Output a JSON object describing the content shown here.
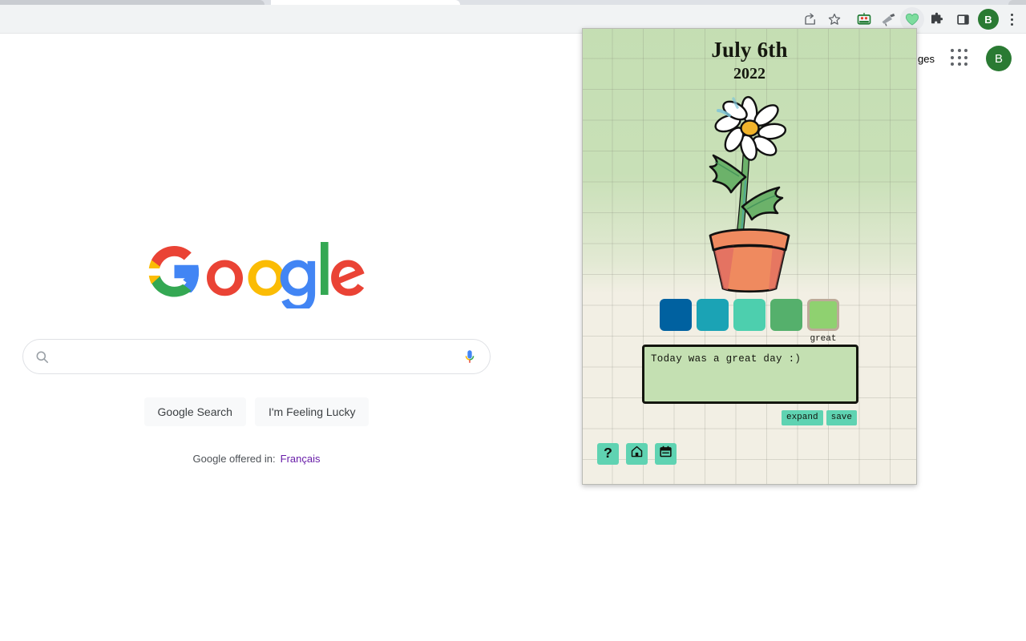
{
  "browser": {
    "toolbar_icons": [
      {
        "name": "share-icon",
        "glyph": "share"
      },
      {
        "name": "bookmark-star-icon",
        "glyph": "star"
      }
    ],
    "extensions": [
      {
        "name": "robot-extension-icon",
        "label": ""
      },
      {
        "name": "telescope-extension-icon",
        "label": ""
      },
      {
        "name": "green-heart-extension-icon",
        "label": "",
        "active": true
      },
      {
        "name": "puzzle-extensions-icon",
        "label": ""
      }
    ],
    "side_panel_label": "",
    "profile_initial": "B",
    "menu_label": ""
  },
  "google": {
    "header_link": "ges",
    "apps_label": "",
    "profile_initial": "B",
    "logo_text": "Google",
    "search": {
      "value": "",
      "placeholder": ""
    },
    "buttons": {
      "search": "Google Search",
      "lucky": "I'm Feeling Lucky"
    },
    "offered": {
      "text": "Google offered in:",
      "language": "Français"
    }
  },
  "popup": {
    "date": "July 6th",
    "year": "2022",
    "plant": {
      "name": "daisy-in-pot",
      "flower_color": "#ffffff",
      "center_color": "#f2b42c",
      "stem_color": "#6cb26a",
      "pot_color": "#ef8a5f",
      "soil_color": "#7d1f20"
    },
    "mood_colors": [
      {
        "name": "mood-swatch-1",
        "hex": "#0061a0",
        "selected": false
      },
      {
        "name": "mood-swatch-2",
        "hex": "#1ba3b5",
        "selected": false
      },
      {
        "name": "mood-swatch-3",
        "hex": "#4dcfae",
        "selected": false
      },
      {
        "name": "mood-swatch-4",
        "hex": "#55b06c",
        "selected": false
      },
      {
        "name": "mood-swatch-5",
        "hex": "#8fd170",
        "selected": true
      }
    ],
    "selected_mood_label": "great",
    "entry": {
      "value": "Today was a great day :)",
      "placeholder": ""
    },
    "entry_actions": {
      "expand": "expand",
      "save": "save"
    },
    "tools": [
      {
        "name": "help-button",
        "glyph": "?"
      },
      {
        "name": "home-button",
        "glyph": "home"
      },
      {
        "name": "calendar-button",
        "glyph": "calendar"
      }
    ],
    "accent_color": "#5fd3b2",
    "fill_color": "#b3d8a0"
  }
}
